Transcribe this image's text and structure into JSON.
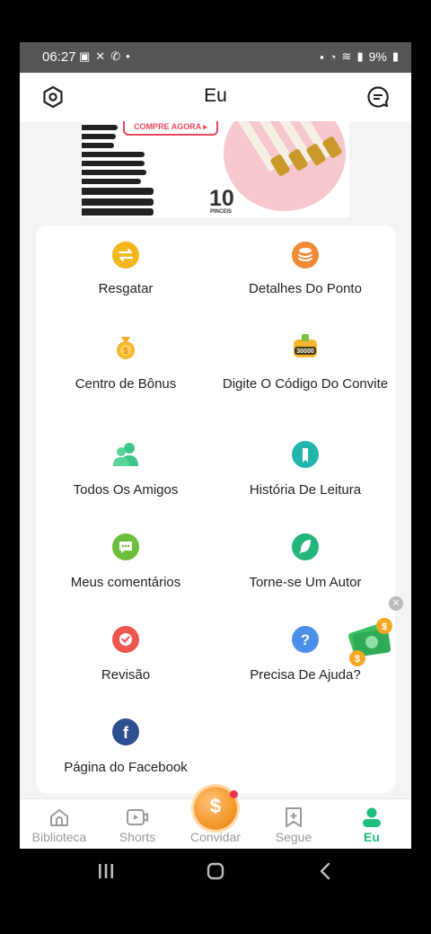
{
  "status_bar": {
    "time": "06:27",
    "battery": "9%",
    "left_icons": [
      "image-icon",
      "gallery-icon",
      "whatsapp-icon",
      "dot-icon"
    ],
    "right_icons": [
      "lock-icon",
      "alarm-icon",
      "wifi-icon",
      "signal-icon",
      "battery-icon"
    ]
  },
  "header": {
    "title": "Eu",
    "left_icon": "settings-icon",
    "right_icon": "message-icon"
  },
  "banner": {
    "button_text": "COMPRE AGORA ▸",
    "count": "10",
    "subtitle": "PINCEIS"
  },
  "menu": [
    {
      "label": "Resgatar",
      "icon": "exchange-icon",
      "color": "#f2b51a"
    },
    {
      "label": "Detalhes Do Ponto",
      "icon": "coins-stack-icon",
      "color": "#f08a37"
    },
    {
      "label": "Centro de Bônus",
      "icon": "coin-bag-icon",
      "color": "#f5b82e"
    },
    {
      "label": "Digite O Código Do Convite",
      "icon": "code-box-icon",
      "color": "#f5b82e",
      "badge": "30000"
    },
    {
      "label": "Todos Os Amigos",
      "icon": "friends-icon",
      "color": "#3cc68a"
    },
    {
      "label": "História De Leitura",
      "icon": "reading-history-icon",
      "color": "#22b5ad"
    },
    {
      "label": "Meus comentários",
      "icon": "comment-icon",
      "color": "#6cbf3a"
    },
    {
      "label": "Torne-se Um Autor",
      "icon": "feather-icon",
      "color": "#24b57b"
    },
    {
      "label": "Revisão",
      "icon": "review-icon",
      "color": "#ef5650"
    },
    {
      "label": "Precisa De Ajuda?",
      "icon": "help-icon",
      "color": "#4a90e8"
    },
    {
      "label": "Página do Facebook",
      "icon": "facebook-icon",
      "color": "#2d4f8f"
    }
  ],
  "bottom_nav": [
    {
      "label": "Biblioteca",
      "icon": "home-icon"
    },
    {
      "label": "Shorts",
      "icon": "video-icon"
    },
    {
      "label": "Convidar",
      "icon": "dollar-coin-icon",
      "coin_symbol": "$"
    },
    {
      "label": "Segue",
      "icon": "bookmark-add-icon"
    },
    {
      "label": "Eu",
      "icon": "person-icon"
    }
  ],
  "colors": {
    "accent": "#1fbf7f",
    "badge_red": "#e8334a"
  }
}
